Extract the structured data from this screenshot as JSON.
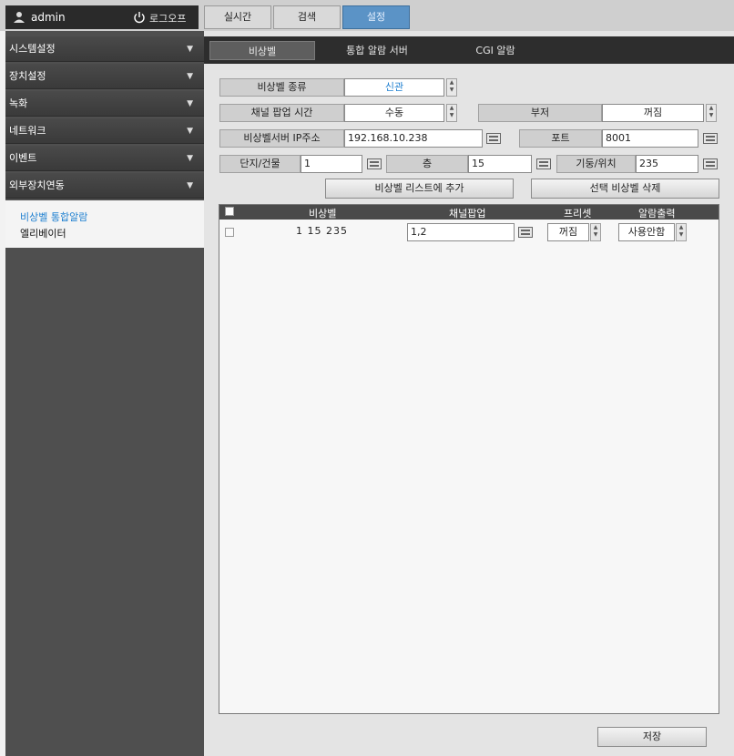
{
  "header": {
    "username": "admin",
    "logoff_label": "로그오프",
    "tabs": [
      {
        "label": "실시간"
      },
      {
        "label": "검색"
      },
      {
        "label": "설정"
      }
    ]
  },
  "sidebar": {
    "items": [
      {
        "label": "시스템설정"
      },
      {
        "label": "장치설정"
      },
      {
        "label": "녹화"
      },
      {
        "label": "네트워크"
      },
      {
        "label": "이벤트"
      },
      {
        "label": "외부장치연동"
      }
    ],
    "sub_items": [
      {
        "label": "비상벨 통합알람"
      },
      {
        "label": "엘리베이터"
      }
    ]
  },
  "subtabs": [
    {
      "label": "비상벨"
    },
    {
      "label": "통합 알람 서버"
    },
    {
      "label": "CGI 알람"
    }
  ],
  "form": {
    "type_label": "비상벨 종류",
    "type_value": "신관",
    "popup_time_label": "채널 팝업 시간",
    "popup_time_value": "수동",
    "buzzer_label": "부저",
    "buzzer_value": "꺼짐",
    "server_ip_label": "비상벨서버 IP주소",
    "server_ip_value": "192.168.10.238",
    "port_label": "포트",
    "port_value": "8001",
    "building_label": "단지/건물",
    "building_value": "1",
    "floor_label": "층",
    "floor_value": "15",
    "pillar_label": "기둥/위치",
    "pillar_value": "235"
  },
  "buttons": {
    "add": "비상벨 리스트에 추가",
    "delete": "선택 비상벨 삭제",
    "save": "저장"
  },
  "table": {
    "headers": [
      "비상벨",
      "채널팝업",
      "프리셋",
      "알람출력"
    ],
    "rows": [
      {
        "bell": "1 15 235",
        "channel_popup": "1,2",
        "preset": "꺼짐",
        "alarm_output": "사용안함"
      }
    ]
  },
  "colors": {
    "accent": "#5b93c6",
    "sidebar_bg": "#4f4f4f",
    "highlight_text": "#1e7fd0"
  }
}
